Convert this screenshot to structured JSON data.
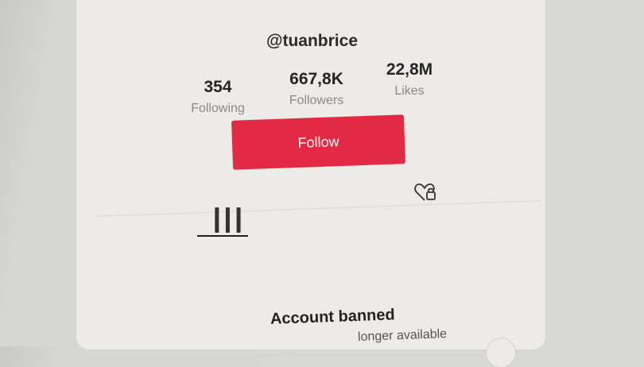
{
  "profile": {
    "username": "@tuanbrice",
    "stats": [
      {
        "value": "354",
        "label": "Following"
      },
      {
        "value": "667,8K",
        "label": "Followers"
      },
      {
        "value": "22,8M",
        "label": "Likes"
      }
    ],
    "follow_label": "Follow",
    "accent_color": "#e32a45"
  },
  "tabs": {
    "videos_icon": "grid-bars-icon",
    "liked_icon": "heart-lock-icon"
  },
  "notice": {
    "title": "Account banned",
    "subtitle": "longer available"
  }
}
